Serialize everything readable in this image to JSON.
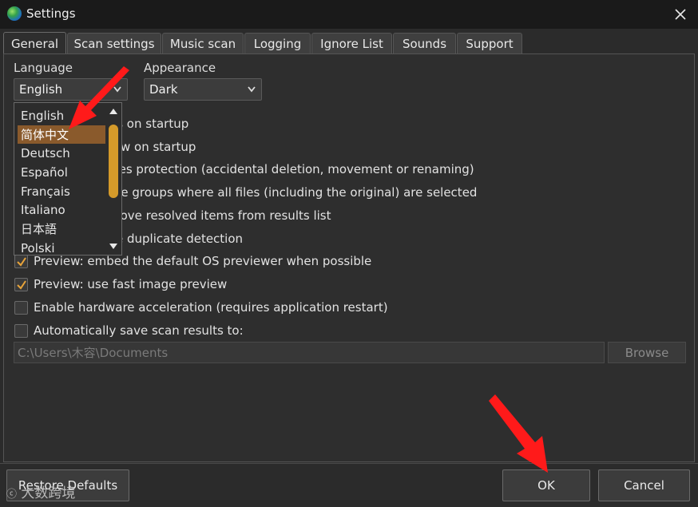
{
  "window": {
    "title": "Settings"
  },
  "tabs": [
    "General",
    "Scan settings",
    "Music scan",
    "Logging",
    "Ignore List",
    "Sounds",
    "Support"
  ],
  "active_tab": "General",
  "language": {
    "label": "Language",
    "value": "English",
    "options": [
      "English",
      "简体中文",
      "Deutsch",
      "Español",
      "Français",
      "Italiano",
      "日本語",
      "Polski"
    ],
    "highlighted_option": "简体中文"
  },
  "appearance": {
    "label": "Appearance",
    "value": "Dark"
  },
  "options": [
    {
      "text": "es on startup",
      "checked": false
    },
    {
      "text": "w on startup",
      "checked": false
    },
    {
      "text": "files protection (accidental deletion, movement or renaming)",
      "checked": false
    },
    {
      "text": "the groups where all files (including the original) are selected",
      "checked": false
    },
    {
      "text": "move resolved items from results list",
      "checked": false
    },
    {
      "text": "e duplicate detection",
      "checked": false
    },
    {
      "text": "Preview: embed the default OS previewer when possible",
      "checked": true
    },
    {
      "text": "Preview: use fast image preview",
      "checked": true
    },
    {
      "text": "Enable hardware acceleration (requires application restart)",
      "checked": false
    },
    {
      "text": "Automatically save scan results to:",
      "checked": false
    }
  ],
  "save_path": {
    "value": "C:\\Users\\木容\\Documents"
  },
  "browse_label": "Browse",
  "buttons": {
    "restore": "Restore Defaults",
    "ok": "OK",
    "cancel": "Cancel"
  },
  "watermark": "大数跨境",
  "colors": {
    "accent": "#d49a2a",
    "selection": "#8a5a2c",
    "annotation_arrow": "#ff1a1a"
  }
}
